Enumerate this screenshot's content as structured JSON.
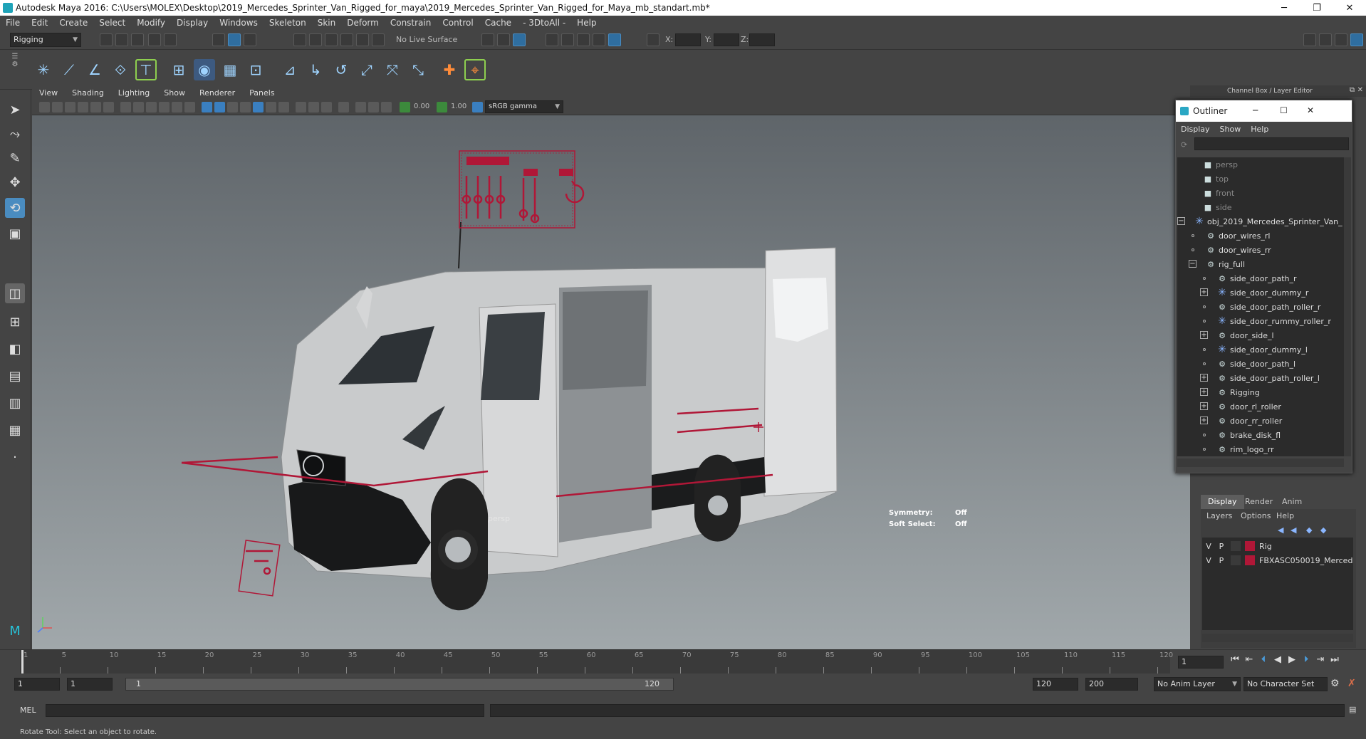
{
  "window": {
    "title": "Autodesk Maya 2016: C:\\Users\\MOLEX\\Desktop\\2019_Mercedes_Sprinter_Van_Rigged_for_maya\\2019_Mercedes_Sprinter_Van_Rigged_for_Maya_mb_standart.mb*",
    "minimize": "─",
    "maximize": "❐",
    "close": "✕"
  },
  "menubar": [
    "File",
    "Edit",
    "Create",
    "Select",
    "Modify",
    "Display",
    "Windows",
    "Skeleton",
    "Skin",
    "Deform",
    "Constrain",
    "Control",
    "Cache",
    "- 3DtoAll -",
    "Help"
  ],
  "statusline": {
    "mode": "Rigging",
    "live_surface": "No Live Surface",
    "x_label": "X:",
    "y_label": "Y:",
    "z_label": "Z:"
  },
  "viewport": {
    "menu": [
      "View",
      "Shading",
      "Lighting",
      "Show",
      "Renderer",
      "Panels"
    ],
    "exposure": "0.00",
    "gamma": "1.00",
    "color_space": "sRGB gamma",
    "camera": "persp",
    "symmetry_label": "Symmetry:",
    "symmetry_value": "Off",
    "soft_select_label": "Soft Select:",
    "soft_select_value": "Off"
  },
  "channelbox": {
    "title": "Channel Box / Layer Editor"
  },
  "outliner": {
    "title": "Outliner",
    "menu": [
      "Display",
      "Show",
      "Help"
    ],
    "items": [
      {
        "name": "persp",
        "kind": "camera",
        "depth": 2
      },
      {
        "name": "top",
        "kind": "camera",
        "depth": 2
      },
      {
        "name": "front",
        "kind": "camera",
        "depth": 2
      },
      {
        "name": "side",
        "kind": "camera",
        "depth": 2
      },
      {
        "name": "obj_2019_Mercedes_Sprinter_Van_",
        "kind": "group",
        "depth": 1,
        "expand": "−"
      },
      {
        "name": "door_wires_rl",
        "kind": "curve",
        "depth": 2
      },
      {
        "name": "door_wires_rr",
        "kind": "curve",
        "depth": 2
      },
      {
        "name": "rig_full",
        "kind": "curve",
        "depth": 2,
        "expand": "−"
      },
      {
        "name": "side_door_path_r",
        "kind": "curve",
        "depth": 3
      },
      {
        "name": "side_door_dummy_r",
        "kind": "group",
        "depth": 3,
        "expand": "+"
      },
      {
        "name": "side_door_path_roller_r",
        "kind": "curve",
        "depth": 3
      },
      {
        "name": "side_door_rummy_roller_r",
        "kind": "group",
        "depth": 3
      },
      {
        "name": "door_side_l",
        "kind": "curve",
        "depth": 3,
        "expand": "+"
      },
      {
        "name": "side_door_dummy_l",
        "kind": "group",
        "depth": 3
      },
      {
        "name": "side_door_path_l",
        "kind": "curve",
        "depth": 3
      },
      {
        "name": "side_door_path_roller_l",
        "kind": "curve",
        "depth": 3,
        "expand": "+"
      },
      {
        "name": "Rigging",
        "kind": "curve",
        "depth": 3,
        "expand": "+"
      },
      {
        "name": "door_rl_roller",
        "kind": "curve",
        "depth": 3,
        "expand": "+"
      },
      {
        "name": "door_rr_roller",
        "kind": "curve",
        "depth": 3,
        "expand": "+"
      },
      {
        "name": "brake_disk_fl",
        "kind": "curve",
        "depth": 3
      },
      {
        "name": "rim_logo_rr",
        "kind": "curve",
        "depth": 3
      }
    ]
  },
  "layers": {
    "tabs": [
      "Display",
      "Render",
      "Anim"
    ],
    "menu": [
      "Layers",
      "Options",
      "Help"
    ],
    "rows": [
      {
        "v": "V",
        "p": "P",
        "color": "#b01737",
        "name": "Rig"
      },
      {
        "v": "V",
        "p": "P",
        "color": "#b01737",
        "name": "FBXASC050019_Merced"
      }
    ]
  },
  "timeline": {
    "ticks": [
      "1",
      "5",
      "10",
      "15",
      "20",
      "25",
      "30",
      "35",
      "40",
      "45",
      "50",
      "55",
      "60",
      "65",
      "70",
      "75",
      "80",
      "85",
      "90",
      "95",
      "100",
      "105",
      "110",
      "115",
      "120"
    ],
    "current_frame": "1"
  },
  "range": {
    "start": "1",
    "playback_start": "1",
    "slider_start": "1",
    "slider_end": "120",
    "playback_end": "120",
    "end": "200",
    "anim_layer": "No Anim Layer",
    "char_set": "No Character Set"
  },
  "cmdline": {
    "label": "MEL"
  },
  "helpline": {
    "text": "Rotate Tool: Select an object to rotate."
  },
  "colors": {
    "rig": "#b01737",
    "accent": "#4a8cc0",
    "bg": "#444444"
  }
}
